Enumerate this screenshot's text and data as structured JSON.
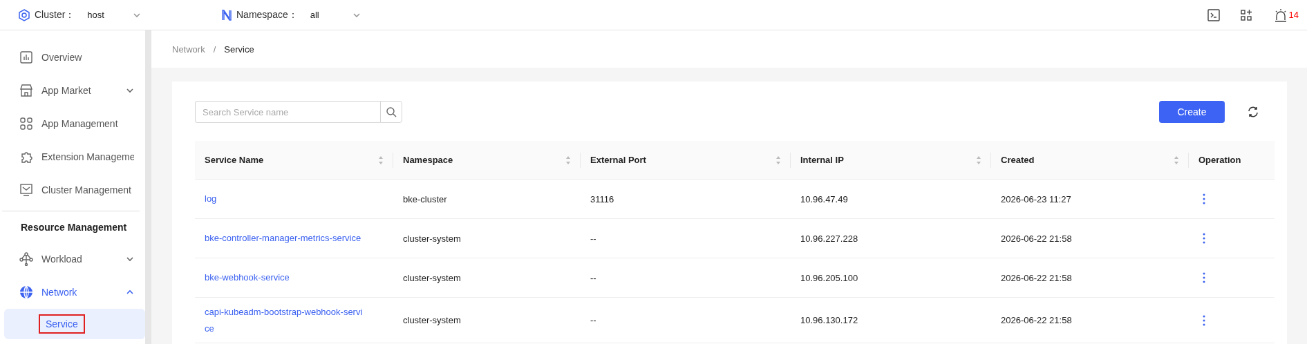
{
  "header": {
    "cluster": {
      "label": "Cluster：",
      "value": "host"
    },
    "namespace": {
      "label": "Namespace：",
      "value": "all"
    },
    "alert_count": "14"
  },
  "sidebar": {
    "items": [
      {
        "kind": "link",
        "label": "Overview"
      },
      {
        "kind": "group",
        "label": "App Market",
        "expanded": false
      },
      {
        "kind": "link",
        "label": "App Management"
      },
      {
        "kind": "link",
        "label": "Extension Manageme"
      },
      {
        "kind": "link",
        "label": "Cluster Management"
      },
      {
        "kind": "section",
        "label": "Resource Management"
      },
      {
        "kind": "group",
        "label": "Workload",
        "expanded": false
      },
      {
        "kind": "group",
        "label": "Network",
        "expanded": true,
        "active": true,
        "children": [
          {
            "label": "Service",
            "selected": true,
            "highlighted": true
          }
        ]
      }
    ]
  },
  "breadcrumb": {
    "items": [
      "Network",
      "Service"
    ],
    "separator": "/"
  },
  "search": {
    "placeholder": "Search Service name"
  },
  "create_button": "Create",
  "table": {
    "columns": [
      {
        "label": "Service Name",
        "sortable": true
      },
      {
        "label": "Namespace",
        "sortable": true
      },
      {
        "label": "External Port",
        "sortable": true
      },
      {
        "label": "Internal IP",
        "sortable": true
      },
      {
        "label": "Created",
        "sortable": true
      },
      {
        "label": "Operation",
        "sortable": false
      }
    ],
    "rows": [
      {
        "name": "log",
        "namespace": "bke-cluster",
        "external_port": "31116",
        "internal_ip": "10.96.47.49",
        "created": "2026-06-23 11:27"
      },
      {
        "name": "bke-controller-manager-metrics-service",
        "namespace": "cluster-system",
        "external_port": "--",
        "internal_ip": "10.96.227.228",
        "created": "2026-06-22 21:58"
      },
      {
        "name": "bke-webhook-service",
        "namespace": "cluster-system",
        "external_port": "--",
        "internal_ip": "10.96.205.100",
        "created": "2026-06-22 21:58"
      },
      {
        "name": "capi-kubeadm-bootstrap-webhook-servi\nce",
        "namespace": "cluster-system",
        "external_port": "--",
        "internal_ip": "10.96.130.172",
        "created": "2026-06-22 21:58"
      }
    ]
  }
}
